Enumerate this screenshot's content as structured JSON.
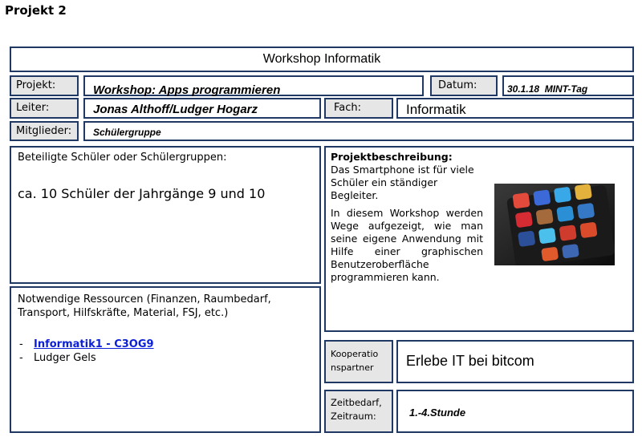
{
  "page_title": "Projekt 2",
  "header": {
    "title": "Workshop Informatik"
  },
  "fields": {
    "projekt_label": "Projekt:",
    "projekt_value": "Workshop: Apps programmieren",
    "datum_label": "Datum:",
    "datum_value": "30.1.18  MINT-Tag",
    "leiter_label": "Leiter:",
    "leiter_value": "Jonas Althoff/Ludger Hogarz",
    "fach_label": "Fach:",
    "fach_value": "Informatik",
    "mitglieder_label": "Mitglieder:",
    "mitglieder_value": "Schülergruppe"
  },
  "beteiligte": {
    "label": "Beteiligte Schüler oder Schülergruppen:",
    "value": "ca. 10 Schüler der Jahrgänge 9 und 10"
  },
  "beschreibung": {
    "label": "Projektbeschreibung:",
    "para1": "Das Smartphone ist für viele Schüler ein ständiger Begleiter.",
    "para2": "In diesem Workshop werden Wege aufgezeigt, wie man seine eigene Anwendung mit Hilfe einer graphischen Benutzeroberfläche programmieren kann."
  },
  "ressourcen": {
    "label": "Notwendige Ressourcen (Finanzen, Raumbedarf, Transport, Hilfskräfte, Material, FSJ,  etc.)",
    "items": [
      "Informatik1 - C3OG9",
      "Ludger Gels"
    ]
  },
  "kooperation": {
    "label": "Kooperationspartner",
    "value": "Erlebe IT bei bitcom"
  },
  "zeit": {
    "label": "Zeitbedarf, Zeitraum:",
    "value": "1.-4.Stunde"
  },
  "colors": {
    "border": "#1f3864",
    "label_bg": "#e7e6e6",
    "link": "#0b1fd6"
  },
  "image": {
    "icon": "smartphone-apps-icon"
  }
}
